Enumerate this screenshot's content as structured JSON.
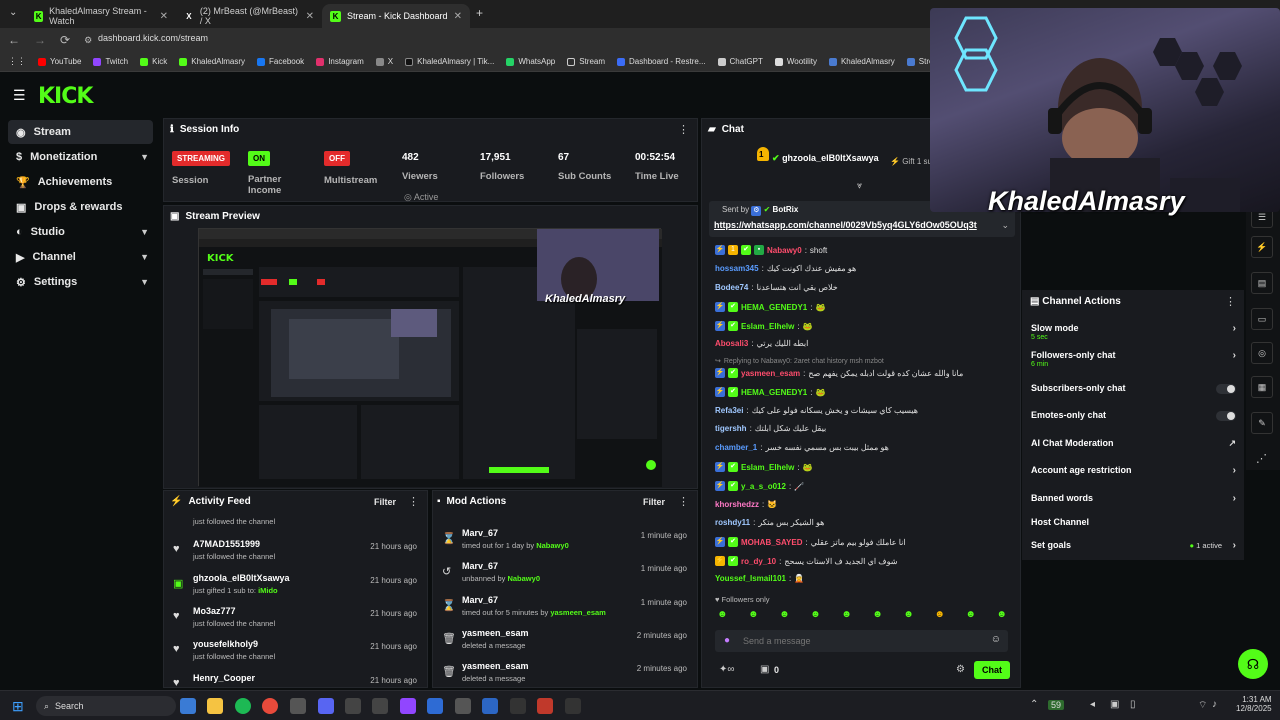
{
  "browser": {
    "tabs": [
      {
        "label": "KhaledAlmasry Stream - Watch"
      },
      {
        "label": "(2) MrBeast (@MrBeast) / X"
      },
      {
        "label": "Stream - Kick Dashboard"
      }
    ],
    "url": "dashboard.kick.com/stream",
    "bookmarks": [
      "YouTube",
      "Twitch",
      "Kick",
      "KhaledAlmasry",
      "Facebook",
      "Instagram",
      "X",
      "KhaledAlmasry | Tik...",
      "WhatsApp",
      "Stream",
      "Dashboard - Restre...",
      "ChatGPT",
      "Wootility",
      "KhaledAlmasry",
      "StreamCharts"
    ]
  },
  "brand": {
    "logo": "KICK",
    "accent": "#53fc18"
  },
  "sidebar": {
    "items": [
      {
        "label": "Stream"
      },
      {
        "label": "Monetization"
      },
      {
        "label": "Achievements"
      },
      {
        "label": "Drops & rewards"
      },
      {
        "label": "Studio"
      },
      {
        "label": "Channel"
      },
      {
        "label": "Settings"
      }
    ]
  },
  "session": {
    "title": "Session Info",
    "streaming_badge": "STREAMING",
    "session_label": "Session",
    "on_badge": "ON",
    "partner_label": "Partner Income",
    "off_badge": "OFF",
    "multistream_label": "Multistream",
    "viewers": "482",
    "viewers_label": "Viewers",
    "active_label": "Active",
    "followers": "17,951",
    "followers_label": "Followers",
    "subs": "67",
    "subs_label": "Sub Counts",
    "time": "00:52:54",
    "time_label": "Time Live"
  },
  "preview": {
    "title": "Stream Preview",
    "overlay_name": "KhaledAlmasry"
  },
  "activity": {
    "title": "Activity Feed",
    "filter": "Filter",
    "top_partial": "just followed the channel",
    "rows": [
      {
        "name": "A7MAD1551999",
        "sub": "just followed the channel",
        "time": "21 hours ago"
      },
      {
        "name": "ghzoola_elB0ltXsawya",
        "sub": "just gifted 1 sub to:",
        "sub_target": "iMido",
        "time": "21 hours ago"
      },
      {
        "name": "Mo3az777",
        "sub": "just followed the channel",
        "time": "21 hours ago"
      },
      {
        "name": "yousefelkholy9",
        "sub": "just followed the channel",
        "time": "21 hours ago"
      },
      {
        "name": "Henry_Cooper",
        "sub": "",
        "time": "21 hours ago"
      }
    ]
  },
  "mod": {
    "title": "Mod Actions",
    "filter": "Filter",
    "rows": [
      {
        "name": "Marv_67",
        "sub": "timed out for 1 day by",
        "by": "Nabawy0",
        "time": "1 minute ago"
      },
      {
        "name": "Marv_67",
        "sub": "unbanned by",
        "by": "Nabawy0",
        "time": "1 minute ago"
      },
      {
        "name": "Marv_67",
        "sub": "timed out for 5 minutes by",
        "by": "yasmeen_esam",
        "time": "1 minute ago"
      },
      {
        "name": "yasmeen_esam",
        "sub": "deleted a message",
        "by": "",
        "time": "2 minutes ago"
      },
      {
        "name": "yasmeen_esam",
        "sub": "deleted a message",
        "by": "",
        "time": "2 minutes ago"
      }
    ]
  },
  "chat": {
    "title": "Chat",
    "pinned_user": "ghzoola_elB0ltXsawya",
    "pinned_count": "1",
    "gift_text": "Gift 1 sub",
    "sent_by": "Sent by",
    "sent_user": "BotRix",
    "link": "https://whatsapp.com/channel/0029Vb5yq4GLY6dOw05OUq3t",
    "messages": [
      {
        "user": "Nabawy0",
        "text": "shoft",
        "color": "#ff4d6d"
      },
      {
        "user": "hossam345",
        "text": "هو مفيش عندك اكونت كيك",
        "color": "#5a9cff"
      },
      {
        "user": "Bodee74",
        "text": "خلاص بقي انت هتساعدنا",
        "color": "#a0c8ff"
      },
      {
        "user": "HEMA_GENEDY1",
        "text": "🐸",
        "color": "#53fc18"
      },
      {
        "user": "Eslam_Elhelw",
        "text": "🐸",
        "color": "#53fc18"
      },
      {
        "user": "Abosali3",
        "text": "ابطه الليك يرتي",
        "color": "#ff4d6d"
      },
      {
        "user": "Replying to Nabawy0: 2aret chat history msh mzbot",
        "text": "",
        "color": "#888888"
      },
      {
        "user": "yasmeen_esam",
        "text": "مانا والله عشان كده قولت ادبله يمكن يفهم صح",
        "color": "#ff4d6d"
      },
      {
        "user": "HEMA_GENEDY1",
        "text": "🐸",
        "color": "#53fc18"
      },
      {
        "user": "Refa3ei",
        "text": "هيسيب كاي سيشات و يخش يسكانه فولو على كيك",
        "color": "#a0c8ff"
      },
      {
        "user": "tigershh",
        "text": "بيقل عليك شكل ابلتك",
        "color": "#a0c8ff"
      },
      {
        "user": "chamber_1",
        "text": "هو ممثل بيبت بس مسمي نفسه خسر",
        "color": "#5a9cff"
      },
      {
        "user": "Eslam_Elhelw",
        "text": "🐸",
        "color": "#53fc18"
      },
      {
        "user": "y_a_s_o012",
        "text": "🦯",
        "color": "#53fc18"
      },
      {
        "user": "khorshedzz",
        "text": "🐱",
        "color": "#ff79c6"
      },
      {
        "user": "roshdy11",
        "text": "هو الشيكر بس متكر",
        "color": "#a0c8ff"
      },
      {
        "user": "MOHAB_SAYED",
        "text": "انا عاملك فولو بيم ماتز عقلي",
        "color": "#ff4d6d"
      },
      {
        "user": "ro_dy_10",
        "text": "شوف اي الجديد ف الاستات يسحج",
        "color": "#ff4d6d"
      },
      {
        "user": "Youssef_Ismail101",
        "text": "🧝",
        "color": "#53fc18"
      }
    ],
    "followers_only": "Followers only",
    "placeholder": "Send a message",
    "count": "0",
    "send": "Chat"
  },
  "channel_actions": {
    "title": "Channel Actions",
    "items": [
      {
        "label": "Slow mode",
        "sub": "5 sec"
      },
      {
        "label": "Followers-only chat",
        "sub": "6 min"
      },
      {
        "label": "Subscribers-only chat",
        "sub": ""
      },
      {
        "label": "Emotes-only chat",
        "sub": ""
      },
      {
        "label": "AI Chat Moderation",
        "sub": ""
      },
      {
        "label": "Account age restriction",
        "sub": ""
      },
      {
        "label": "Banned words",
        "sub": ""
      },
      {
        "label": "Host Channel",
        "sub": ""
      },
      {
        "label": "Set goals",
        "sub": ""
      }
    ],
    "goals_active": "1 active"
  },
  "webcam": {
    "name": "KhaledAlmasry"
  },
  "taskbar": {
    "search": "Search",
    "badge": "59",
    "time": "1:31 AM",
    "date": "12/8/2025"
  }
}
